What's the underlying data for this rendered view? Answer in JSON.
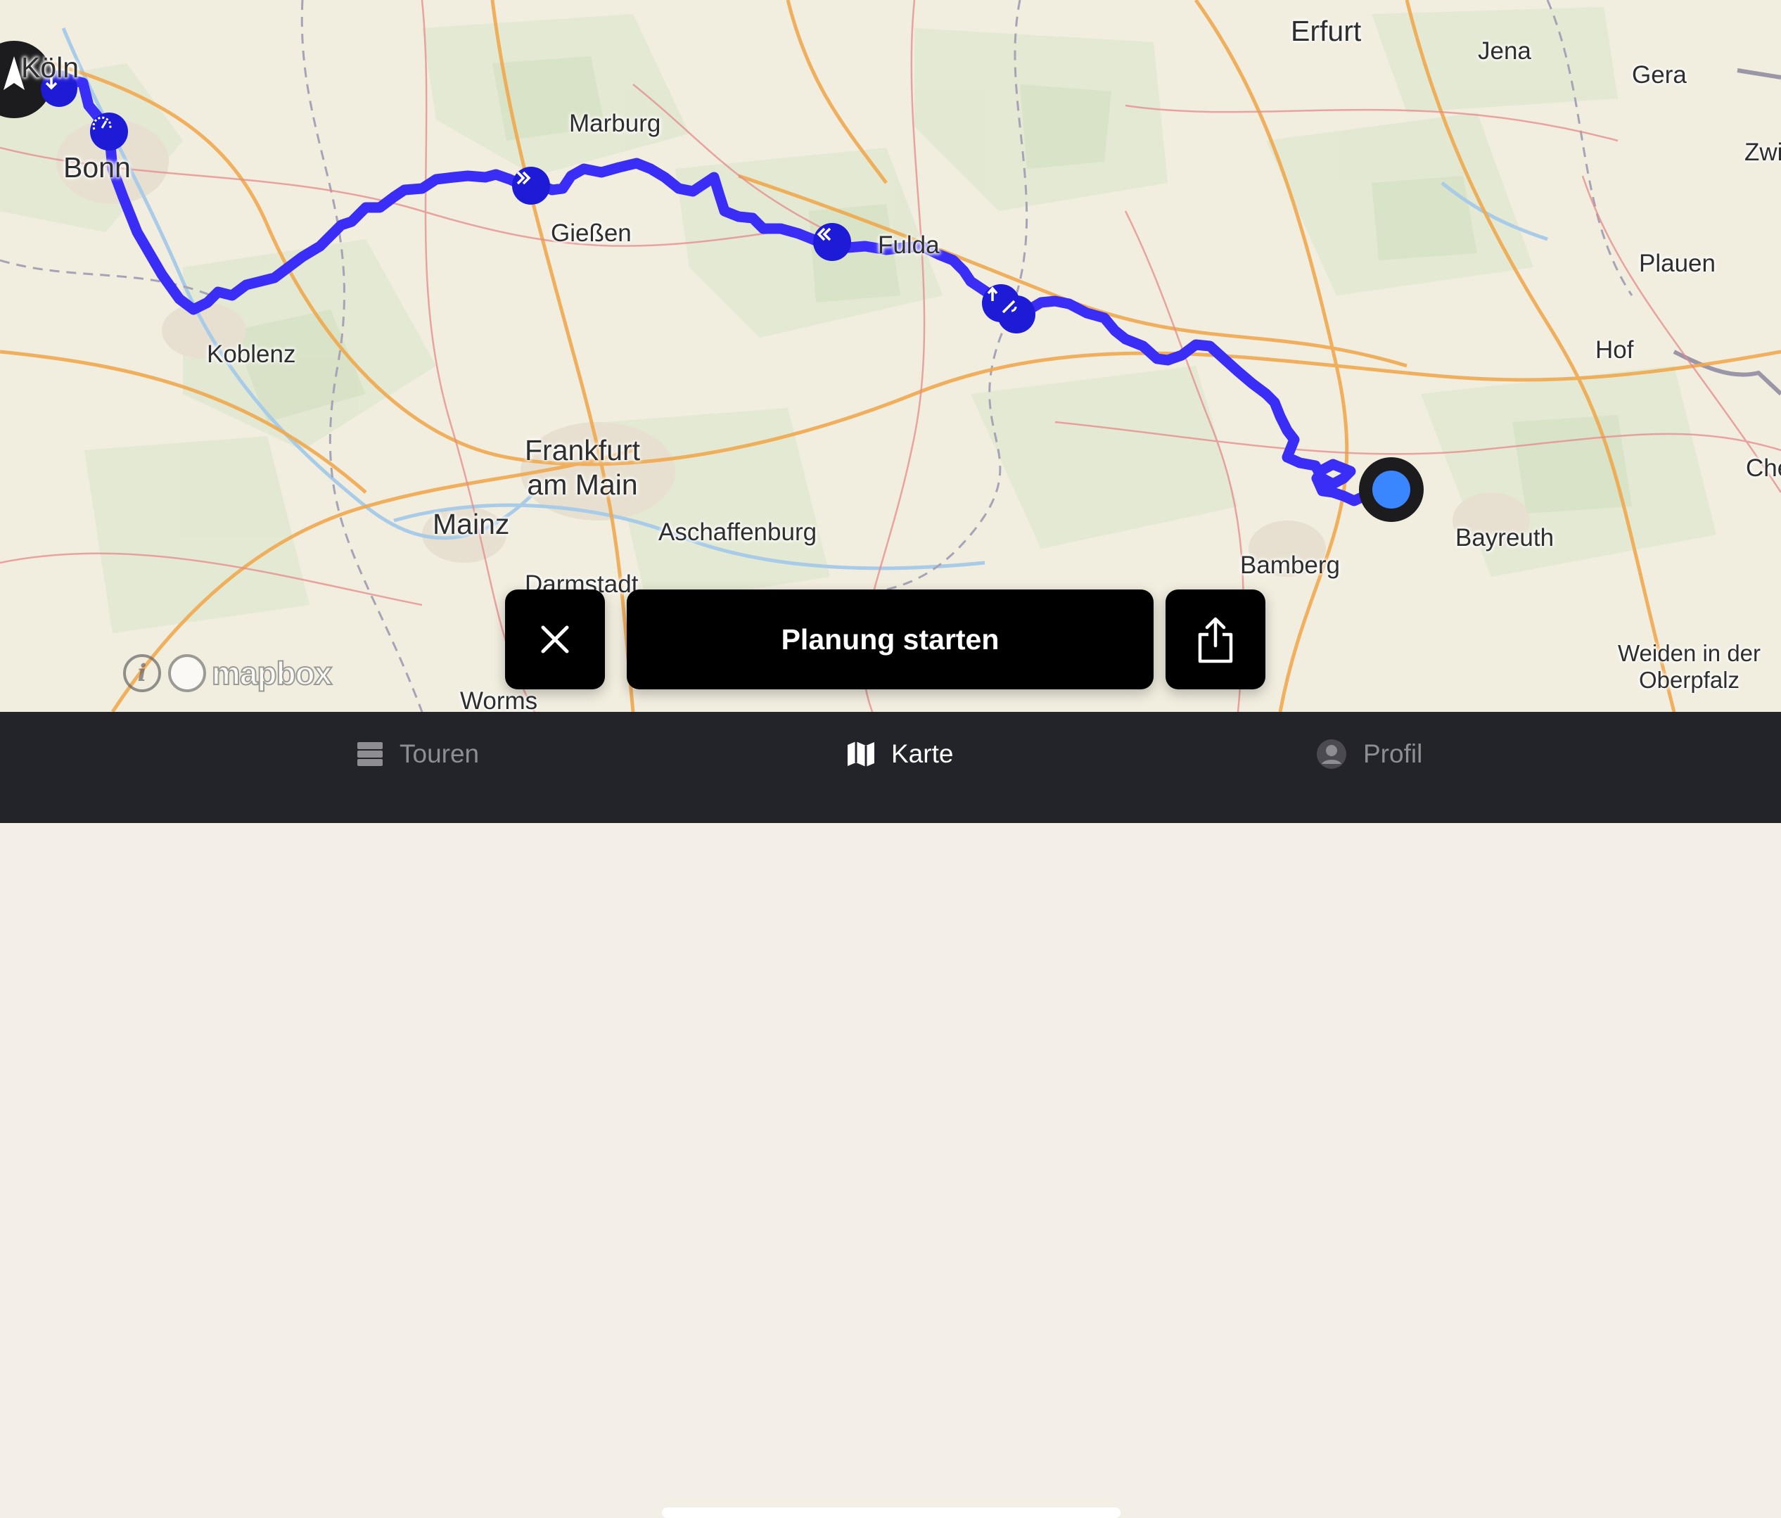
{
  "map": {
    "cities": [
      {
        "key": "koeln",
        "name": "Köln"
      },
      {
        "key": "bonn",
        "name": "Bonn"
      },
      {
        "key": "koblenz",
        "name": "Koblenz"
      },
      {
        "key": "marburg",
        "name": "Marburg"
      },
      {
        "key": "giessen",
        "name": "Gießen"
      },
      {
        "key": "fulda",
        "name": "Fulda"
      },
      {
        "key": "frankfurt",
        "name": "Frankfurt\nam Main"
      },
      {
        "key": "mainz",
        "name": "Mainz"
      },
      {
        "key": "aschaffenburg",
        "name": "Aschaffenburg"
      },
      {
        "key": "darmstadt",
        "name": "Darmstadt"
      },
      {
        "key": "worms",
        "name": "Worms"
      },
      {
        "key": "erfurt",
        "name": "Erfurt"
      },
      {
        "key": "jena",
        "name": "Jena"
      },
      {
        "key": "gera",
        "name": "Gera"
      },
      {
        "key": "zwickau",
        "name": "Zwi"
      },
      {
        "key": "plauen",
        "name": "Plauen"
      },
      {
        "key": "hof",
        "name": "Hof"
      },
      {
        "key": "cheb",
        "name": "Cheb"
      },
      {
        "key": "bayreuth",
        "name": "Bayreuth"
      },
      {
        "key": "bamberg",
        "name": "Bamberg"
      },
      {
        "key": "weiden",
        "name": "Weiden in der\nOberpfalz"
      }
    ],
    "attribution": {
      "logo_text": "mapbox",
      "info_glyph": "i"
    },
    "route_color": "#3a2df5",
    "location_color": "#3a86ff"
  },
  "actions": {
    "close_icon": "close-icon",
    "plan_label": "Planung starten",
    "share_icon": "share-icon"
  },
  "tabs": [
    {
      "label": "Touren",
      "icon": "list-icon",
      "active": false
    },
    {
      "label": "Karte",
      "icon": "map-icon",
      "active": true
    },
    {
      "label": "Profil",
      "icon": "profile-icon",
      "active": false
    }
  ]
}
